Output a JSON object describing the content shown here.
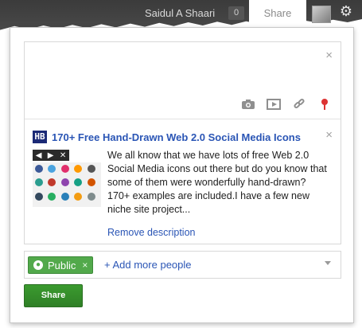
{
  "topbar": {
    "user_name": "Saidul A Shaari",
    "count": "0",
    "share_label": "Share"
  },
  "compose": {
    "close_symbol": "×",
    "attach_icons": [
      "camera-icon",
      "video-icon",
      "link-icon",
      "location-pin-icon"
    ]
  },
  "link_preview": {
    "badge": "HB",
    "title": "170+ Free Hand-Drawn Web 2.0 Social Media Icons",
    "close_symbol": "×",
    "description": "We all know that we have lots of free Web 2.0 Social Media icons out there but do you know that some of them were wonderfully hand-drawn? 170+ examples are included.I have a few new niche site project...",
    "remove_label": "Remove description",
    "thumb_nav": [
      "◀",
      "▶",
      "✕"
    ]
  },
  "audience": {
    "chip_label": "Public",
    "chip_remove": "×",
    "add_more_label": "+ Add more people"
  },
  "actions": {
    "share_button_label": "Share"
  },
  "colors": {
    "accent_link": "#2a55b5",
    "public_chip": "#52a94b",
    "share_button": "#3b9b2f"
  }
}
